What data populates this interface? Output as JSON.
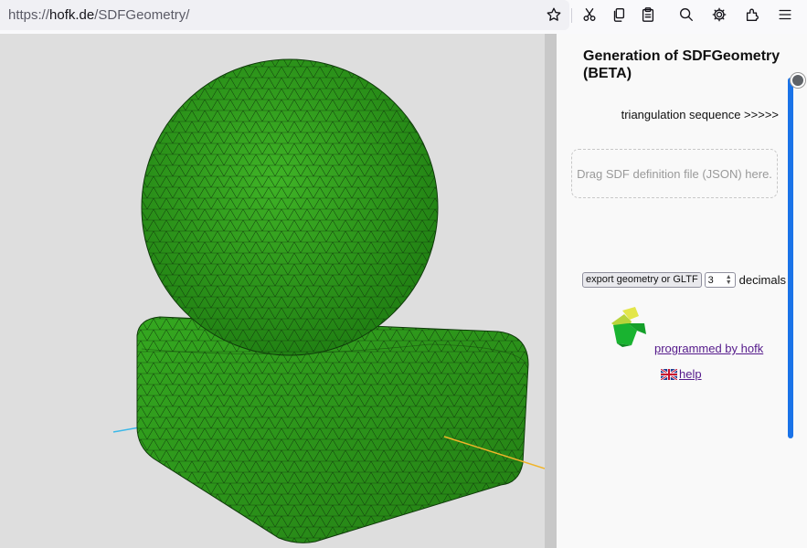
{
  "browser": {
    "url_scheme": "https://",
    "url_host": "hofk.de",
    "url_path": "/SDFGeometry/",
    "toolbar_icons": [
      "bookmark-star-icon",
      "cut-icon",
      "copy-icon",
      "paste-icon",
      "search-icon",
      "settings-gear-icon",
      "extensions-icon",
      "menu-icon"
    ]
  },
  "viewport": {
    "scene": "green triangulated mesh: sphere resting on rounded box",
    "mesh_color": "#2ea01a",
    "wire_color": "#0f3a0a",
    "axis_colors": [
      "#3bb8e8",
      "#f0b429"
    ]
  },
  "panel": {
    "title": "Generation of SDFGeometry (BETA)",
    "sequence_link": "triangulation sequence >>>>>",
    "dropzone_text": "Drag SDF definition file (JSON) here.",
    "export_button": "export geometry or GLTF",
    "decimals_value": "3",
    "decimals_label": "decimals",
    "programmed_by": "programmed by hofk",
    "help": " help"
  }
}
